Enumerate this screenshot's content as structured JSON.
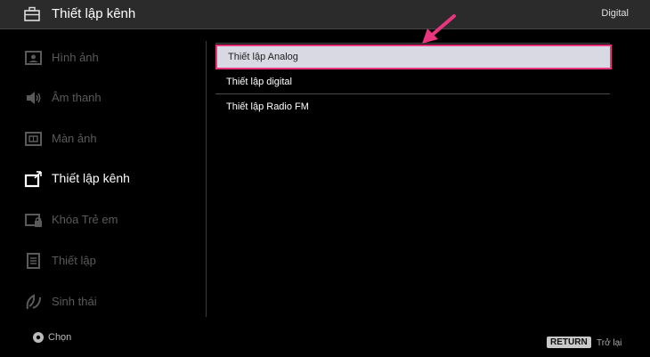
{
  "header": {
    "title": "Thiết lập kênh",
    "mode": "Digital"
  },
  "sidebar": {
    "items": [
      {
        "label": "Hình ảnh",
        "icon": "picture-icon"
      },
      {
        "label": "Âm thanh",
        "icon": "speaker-icon"
      },
      {
        "label": "Màn ảnh",
        "icon": "screen-icon"
      },
      {
        "label": "Thiết lập kênh",
        "icon": "channel-setup-icon",
        "active": true
      },
      {
        "label": "Khóa Trẻ em",
        "icon": "child-lock-icon"
      },
      {
        "label": "Thiết lập",
        "icon": "settings-icon"
      },
      {
        "label": "Sinh thái",
        "icon": "eco-icon"
      }
    ]
  },
  "menu": {
    "items": [
      {
        "label": "Thiết lập Analog",
        "selected": true
      },
      {
        "label": "Thiết lập digital"
      },
      {
        "label": "Thiết lập Radio FM"
      }
    ]
  },
  "footer": {
    "select_label": "Chọn",
    "return_key": "RETURN",
    "return_label": "Trở lại"
  },
  "colors": {
    "highlight_border": "#e8357d",
    "highlight_bg": "#d9d9e4",
    "header_bg": "#2b2b2b"
  }
}
